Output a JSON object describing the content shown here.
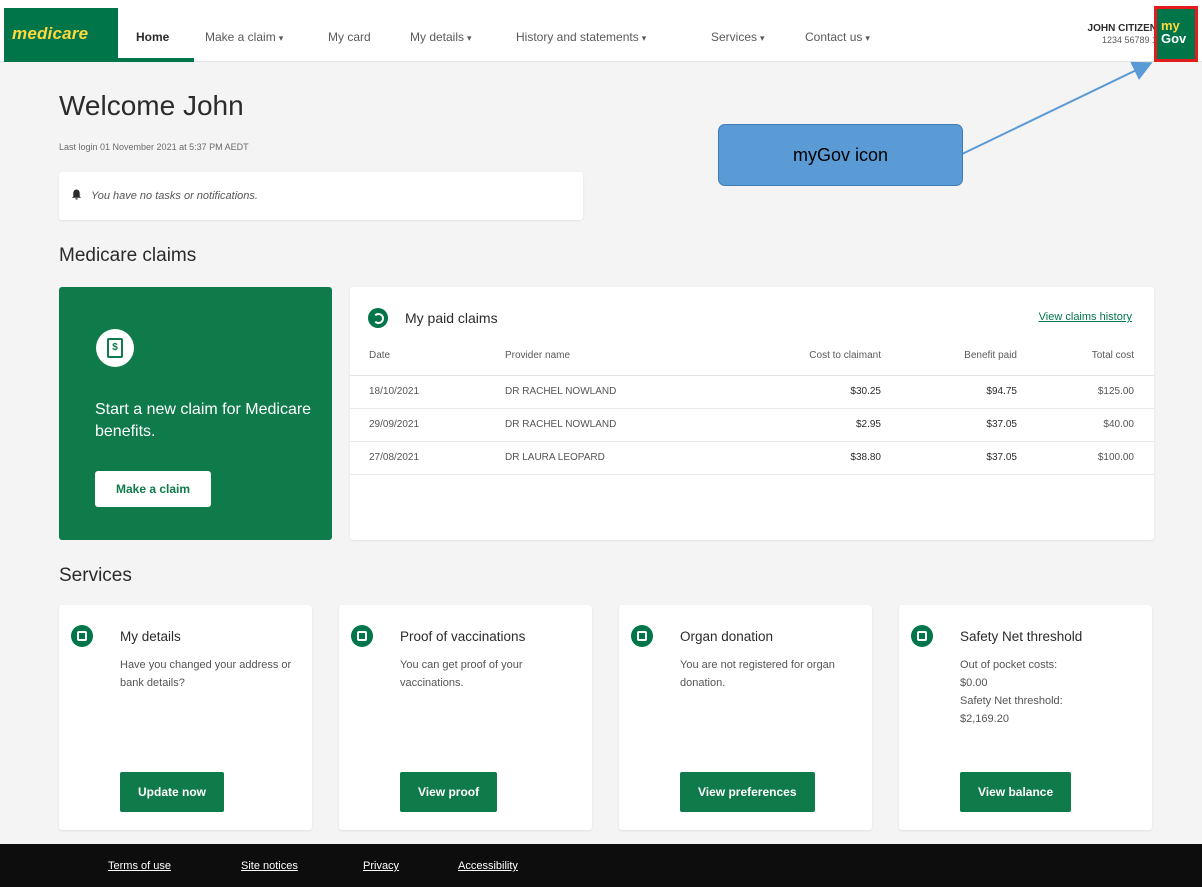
{
  "brand": {
    "logo": "medicare"
  },
  "nav": {
    "items": [
      {
        "label": "Home",
        "dropdown": false,
        "active": true
      },
      {
        "label": "Make a claim",
        "dropdown": true
      },
      {
        "label": "My card",
        "dropdown": false
      },
      {
        "label": "My details",
        "dropdown": true
      },
      {
        "label": "History and statements",
        "dropdown": true
      },
      {
        "label": "Services",
        "dropdown": true
      },
      {
        "label": "Contact us",
        "dropdown": true
      }
    ],
    "caret": "▾"
  },
  "user": {
    "name": "JOHN CITIZEN",
    "crn": "1234 56789 1",
    "mygov_label_top": "my",
    "mygov_label_bottom": "Gov"
  },
  "welcome": {
    "title": "Welcome John",
    "last_login": "Last login 01 November 2021 at 5:37 PM AEDT",
    "notification": "You have no tasks or notifications."
  },
  "claims": {
    "section_title": "Medicare claims",
    "new_claim": {
      "text": "Start a new claim for Medicare benefits.",
      "button": "Make a claim"
    },
    "paid": {
      "title": "My paid claims",
      "history_link": "View claims history",
      "columns": [
        "Date",
        "Provider name",
        "Cost to claimant",
        "Benefit paid",
        "Total cost"
      ],
      "rows": [
        {
          "date": "18/10/2021",
          "provider": "DR RACHEL NOWLAND",
          "cost": "$30.25",
          "benefit": "$94.75",
          "total": "$125.00"
        },
        {
          "date": "29/09/2021",
          "provider": "DR RACHEL NOWLAND",
          "cost": "$2.95",
          "benefit": "$37.05",
          "total": "$40.00"
        },
        {
          "date": "27/08/2021",
          "provider": "DR LAURA LEOPARD",
          "cost": "$38.80",
          "benefit": "$37.05",
          "total": "$100.00"
        }
      ]
    }
  },
  "services": {
    "section_title": "Services",
    "cards": [
      {
        "title": "My details",
        "desc": "Have you changed your address or bank details?",
        "button": "Update now",
        "icon": "id-card-icon"
      },
      {
        "title": "Proof of vaccinations",
        "desc": "You can get proof of your vaccinations.",
        "button": "View proof",
        "icon": "syringe-icon"
      },
      {
        "title": "Organ donation",
        "desc": "You are not registered for organ donation.",
        "button": "View preferences",
        "icon": "heart-icon"
      },
      {
        "title": "Safety Net threshold",
        "desc_lines": [
          "Out of pocket costs:",
          "$0.00",
          "Safety Net threshold:",
          "$2,169.20"
        ],
        "button": "View balance",
        "icon": "safety-net-icon"
      }
    ]
  },
  "footer": {
    "links": [
      "Terms of use",
      "Site notices",
      "Privacy",
      "Accessibility"
    ]
  },
  "callout": {
    "text": "myGov icon",
    "color": "#5b9bd5"
  },
  "colors": {
    "brand_green": "#00754a",
    "accent_yellow": "#ffd83c",
    "mygov_border": "#e31d1d"
  }
}
